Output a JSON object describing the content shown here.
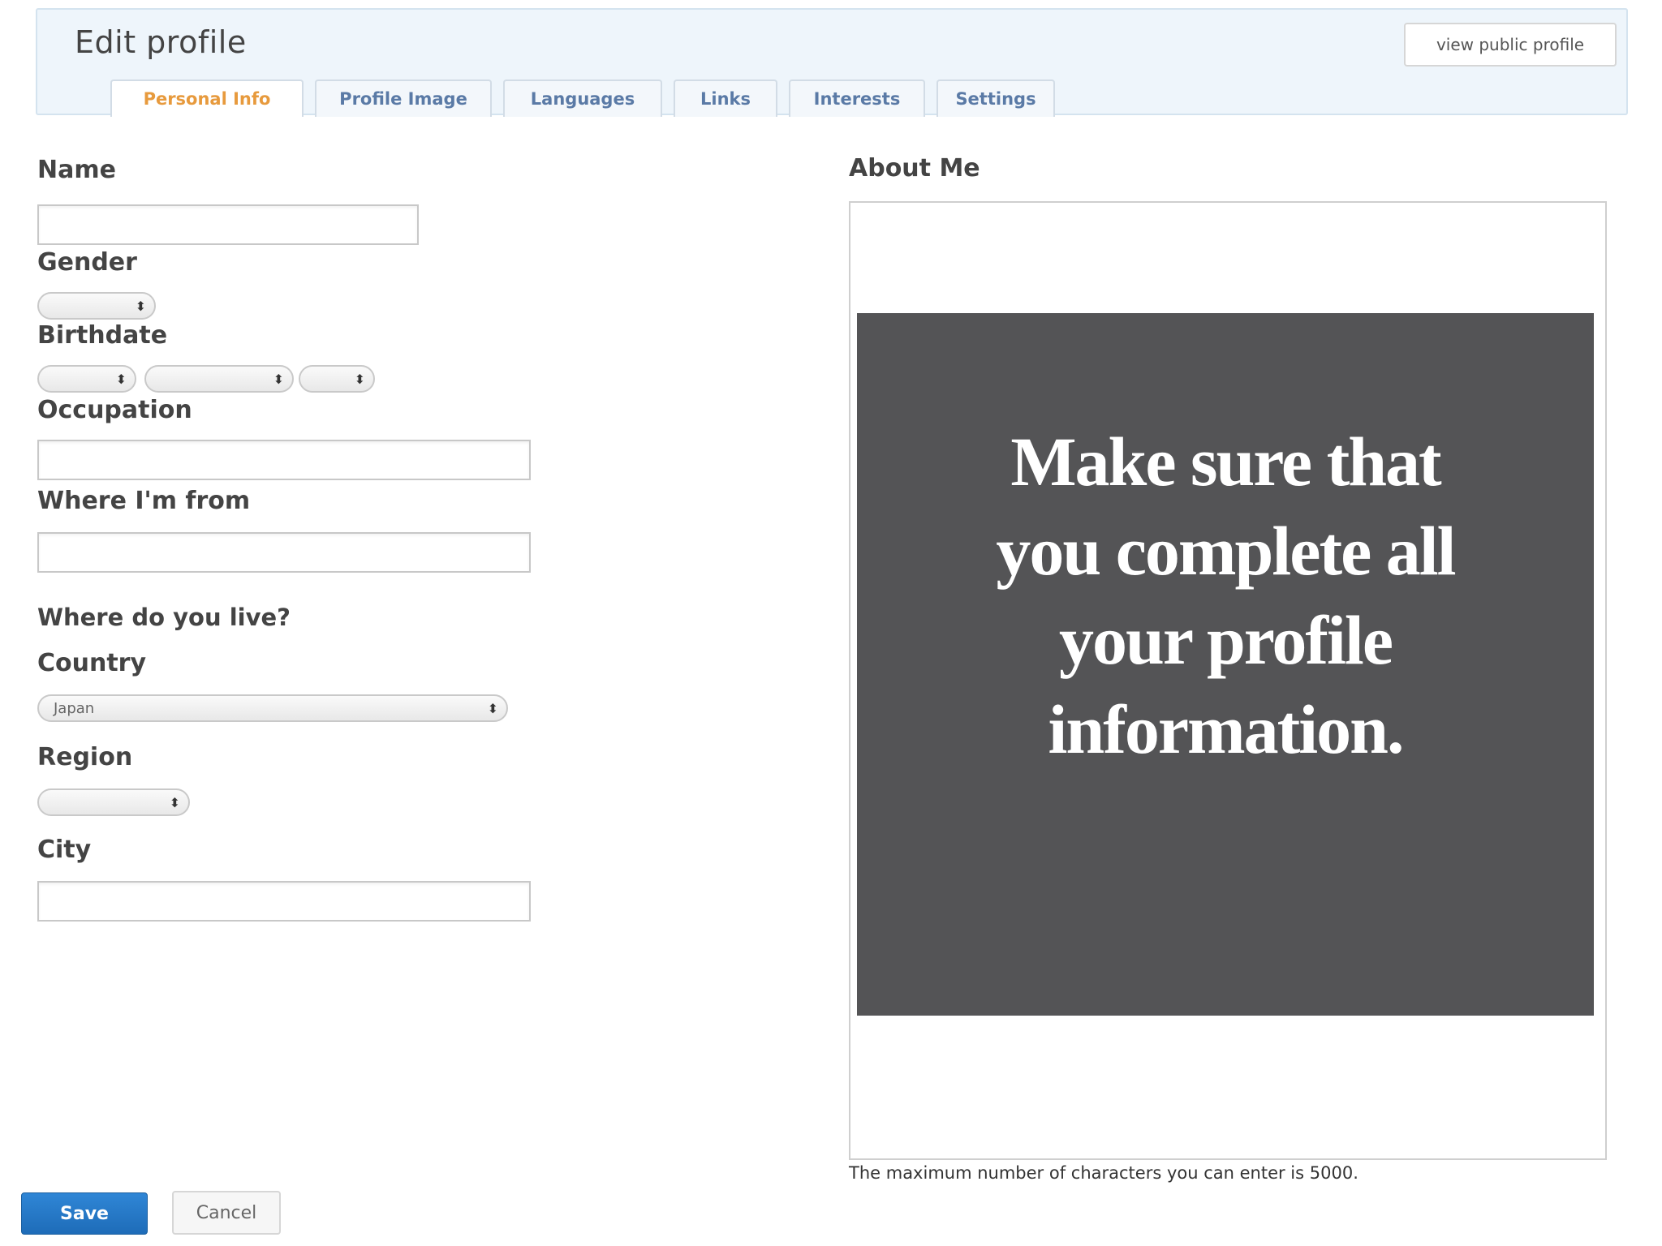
{
  "header": {
    "title": "Edit profile",
    "view_public_label": "view public profile"
  },
  "tabs": [
    {
      "label": "Personal Info",
      "active": true
    },
    {
      "label": "Profile Image",
      "active": false
    },
    {
      "label": "Languages",
      "active": false
    },
    {
      "label": "Links",
      "active": false
    },
    {
      "label": "Interests",
      "active": false
    },
    {
      "label": "Settings",
      "active": false
    }
  ],
  "form": {
    "name_label": "Name",
    "name_value": "",
    "gender_label": "Gender",
    "gender_value": "",
    "birthdate_label": "Birthdate",
    "birth_month_value": "",
    "birth_day_value": "",
    "birth_year_value": "",
    "occupation_label": "Occupation",
    "occupation_value": "",
    "from_label": "Where I'm from",
    "from_value": "",
    "live_heading": "Where do you live?",
    "country_label": "Country",
    "country_value": "Japan",
    "region_label": "Region",
    "region_value": "",
    "city_label": "City",
    "city_value": ""
  },
  "about": {
    "label": "About Me",
    "value": "",
    "limit_note": "The maximum number of characters you can enter is 5000."
  },
  "overlay": {
    "message": "Make sure that you complete all your profile information."
  },
  "actions": {
    "save_label": "Save",
    "cancel_label": "Cancel"
  },
  "colors": {
    "active_tab": "#e79a3d",
    "tab_text": "#5a7aa6",
    "save_button": "#2476c4",
    "overlay_bg": "#545456"
  }
}
